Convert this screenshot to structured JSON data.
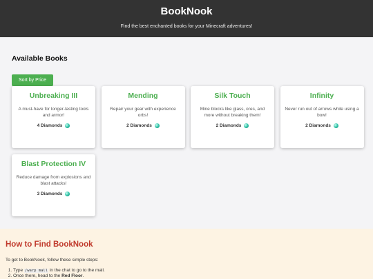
{
  "header": {
    "title": "BookNook",
    "tagline": "Find the best enchanted books for your Minecraft adventures!"
  },
  "books": {
    "heading": "Available Books",
    "sort_label": "Sort by Price",
    "items": [
      {
        "title": "Unbreaking III",
        "desc": "A must-have for longer-lasting tools and armor!",
        "price": "4 Diamonds"
      },
      {
        "title": "Mending",
        "desc": "Repair your gear with experience orbs!",
        "price": "2 Diamonds"
      },
      {
        "title": "Silk Touch",
        "desc": "Mine blocks like glass, ores, and more without breaking them!",
        "price": "2 Diamonds"
      },
      {
        "title": "Infinity",
        "desc": "Never run out of arrows while using a bow!",
        "price": "2 Diamonds"
      },
      {
        "title": "Blast Protection IV",
        "desc": "Reduce damage from explosions and blast attacks!",
        "price": "3 Diamonds"
      }
    ]
  },
  "find": {
    "heading": "How to Find BookNook",
    "intro": "To get to BookNook, follow these simple steps:",
    "step1_pre": "Type ",
    "step1_code": "/warp mall",
    "step1_post": " in the chat to go to the mall.",
    "step2_pre": "Once there, head to the ",
    "step2_bold": "Red Floor",
    "step2_post": "."
  },
  "colors": {
    "accent": "#4caf50",
    "header_bg": "#333333",
    "find_heading": "#c0392b",
    "find_bg": "#fdf3e3"
  },
  "icons": {
    "price": "diamond-icon"
  }
}
